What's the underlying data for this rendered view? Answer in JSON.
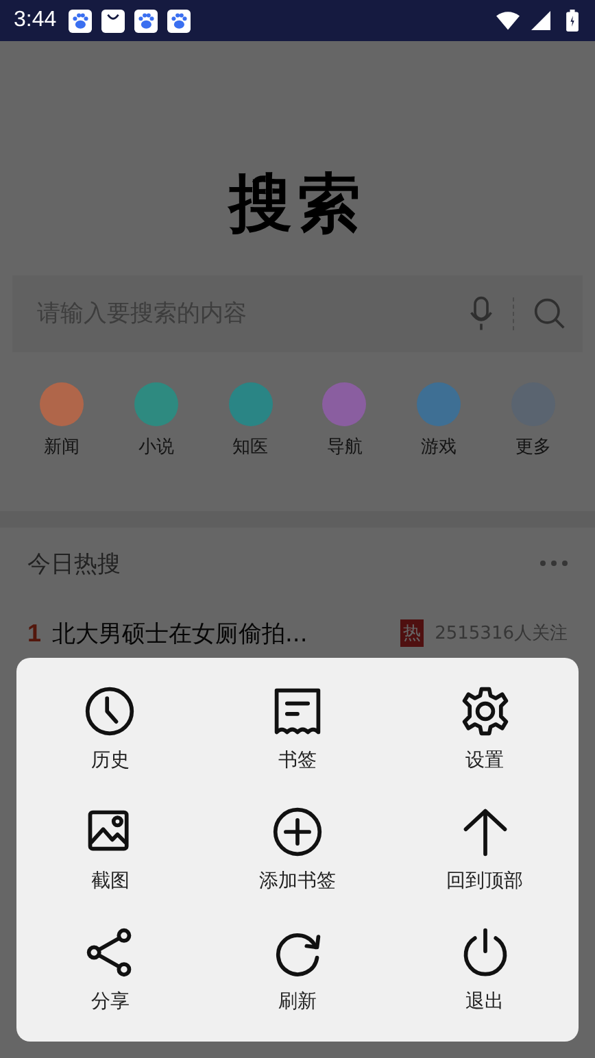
{
  "status_bar": {
    "time": "3:44"
  },
  "title": "搜索",
  "search": {
    "placeholder": "请输入要搜索的内容"
  },
  "shortcuts": [
    {
      "label": "新闻",
      "color": "#b0664a"
    },
    {
      "label": "小说",
      "color": "#2e8a80"
    },
    {
      "label": "知医",
      "color": "#2a8585"
    },
    {
      "label": "导航",
      "color": "#8a5ea0"
    },
    {
      "label": "游戏",
      "color": "#3e6f94"
    },
    {
      "label": "更多",
      "color": "#5a6470"
    }
  ],
  "hot": {
    "title": "今日热搜",
    "items": [
      {
        "rank": "1",
        "headline": "北大男硕士在女厕偷拍...",
        "tag": "热",
        "followers": "2515316人关注"
      }
    ]
  },
  "menu": [
    {
      "kind": "history",
      "label": "历史"
    },
    {
      "kind": "bookmarks",
      "label": "书签"
    },
    {
      "kind": "settings",
      "label": "设置"
    },
    {
      "kind": "screenshot",
      "label": "截图"
    },
    {
      "kind": "add-bookmark",
      "label": "添加书签"
    },
    {
      "kind": "top",
      "label": "回到顶部"
    },
    {
      "kind": "share",
      "label": "分享"
    },
    {
      "kind": "refresh",
      "label": "刷新"
    },
    {
      "kind": "exit",
      "label": "退出"
    }
  ]
}
